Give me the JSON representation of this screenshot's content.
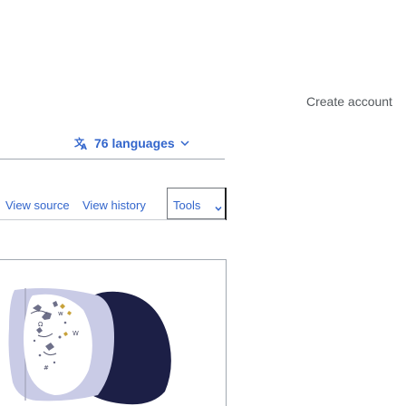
{
  "header": {
    "create_account": "Create account"
  },
  "languages": {
    "label": "76 languages",
    "icon": "translate-icon",
    "chevron": "chevron-down-icon"
  },
  "tabs": {
    "view_source": "View source",
    "view_history": "View history",
    "tools": "Tools"
  },
  "colors": {
    "link": "#3366cc",
    "text_muted": "#54595d",
    "border": "#a2a9b1"
  }
}
